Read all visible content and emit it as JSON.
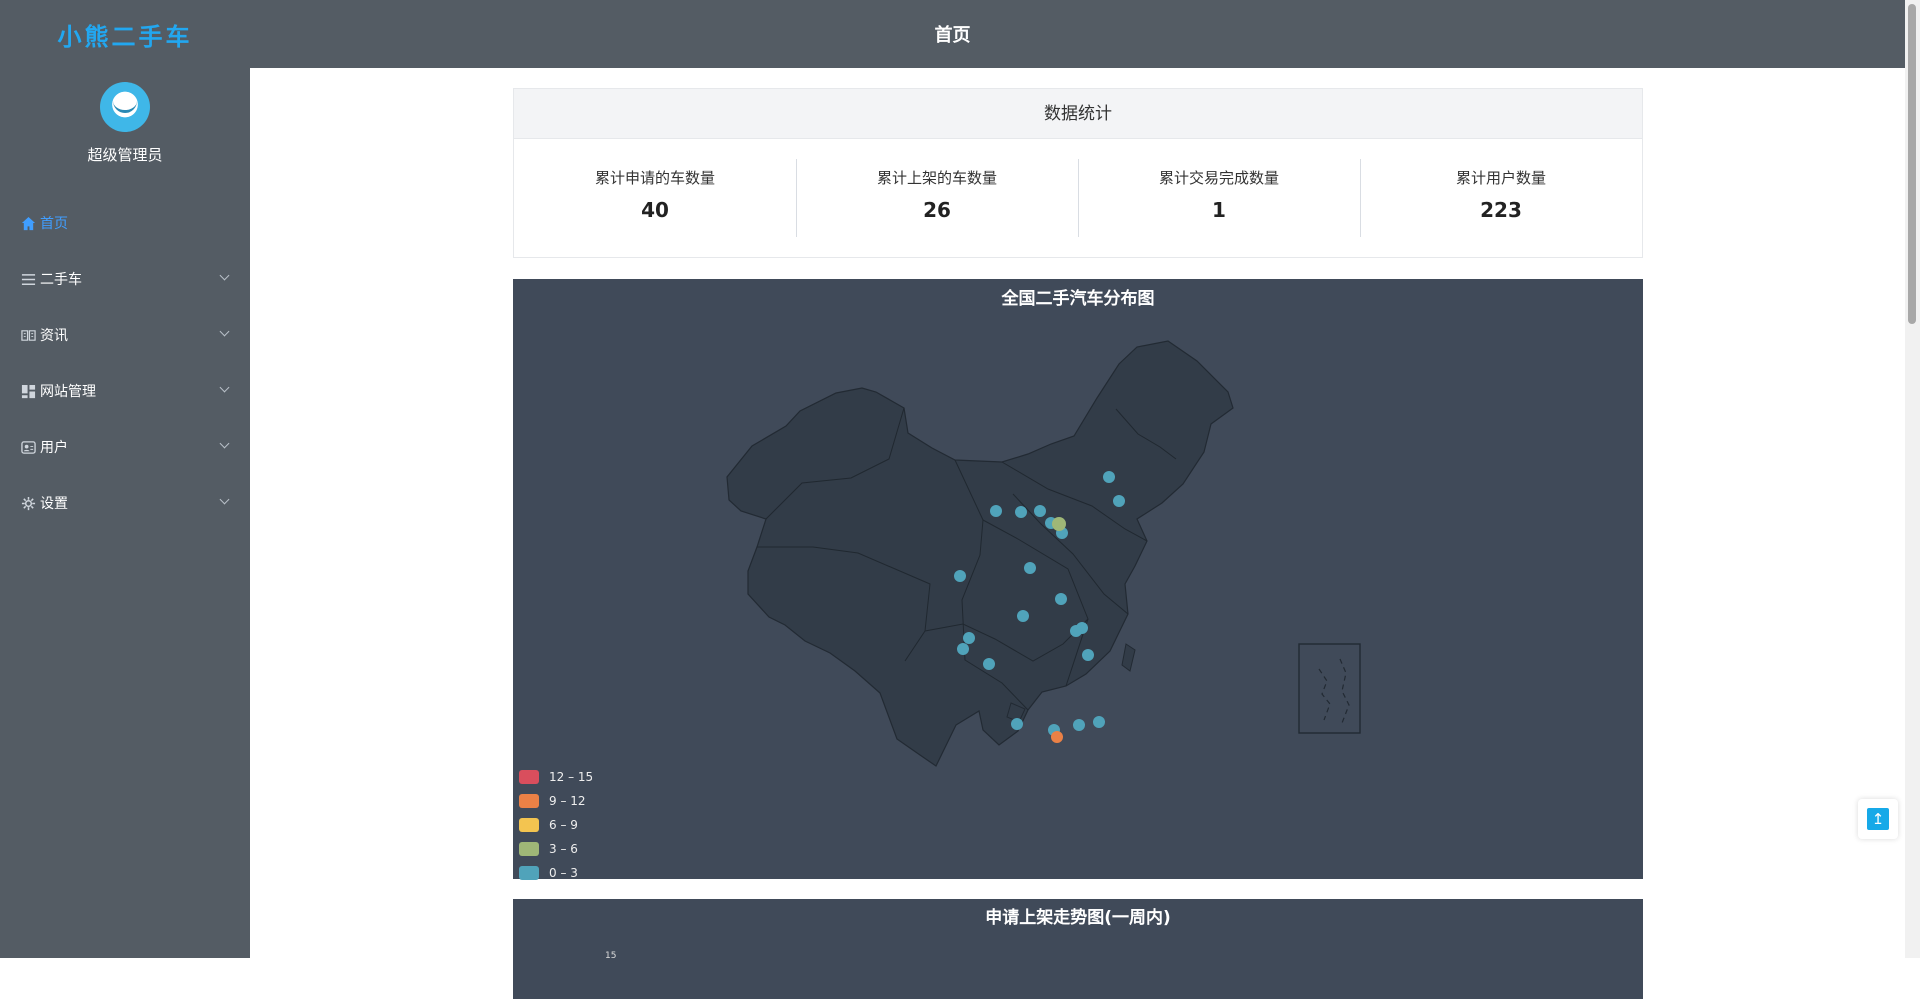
{
  "app": {
    "logo": "小熊二手车",
    "page_title": "首页"
  },
  "profile": {
    "username": "超级管理员"
  },
  "menu": [
    {
      "label": "首页",
      "icon": "home-icon",
      "active": true
    },
    {
      "label": "二手车",
      "icon": "list-icon"
    },
    {
      "label": "资讯",
      "icon": "news-icon"
    },
    {
      "label": "网站管理",
      "icon": "dashboard-icon"
    },
    {
      "label": "用户",
      "icon": "user-card-icon"
    },
    {
      "label": "设置",
      "icon": "gear-icon"
    }
  ],
  "stats": {
    "title": "数据统计",
    "items": [
      {
        "label": "累计申请的车数量",
        "value": "40"
      },
      {
        "label": "累计上架的车数量",
        "value": "26"
      },
      {
        "label": "累计交易完成数量",
        "value": "1"
      },
      {
        "label": "累计用户数量",
        "value": "223"
      }
    ]
  },
  "map": {
    "title": "全国二手汽车分布图",
    "legend": [
      {
        "label": "12 – 15",
        "color": "#d94e5d"
      },
      {
        "label": "9 – 12",
        "color": "#eb8146"
      },
      {
        "label": "6 – 9",
        "color": "#f3c450"
      },
      {
        "label": "3 – 6",
        "color": "#9fb777"
      },
      {
        "label": "0 – 3",
        "color": "#50a3ba"
      }
    ]
  },
  "trend": {
    "title": "申请上架走势图(一周内)",
    "tick": "15"
  },
  "colors": {
    "sidebar": "#545c64",
    "accent": "#409eff",
    "map_bg": "#404a59",
    "province": "#323c48"
  }
}
